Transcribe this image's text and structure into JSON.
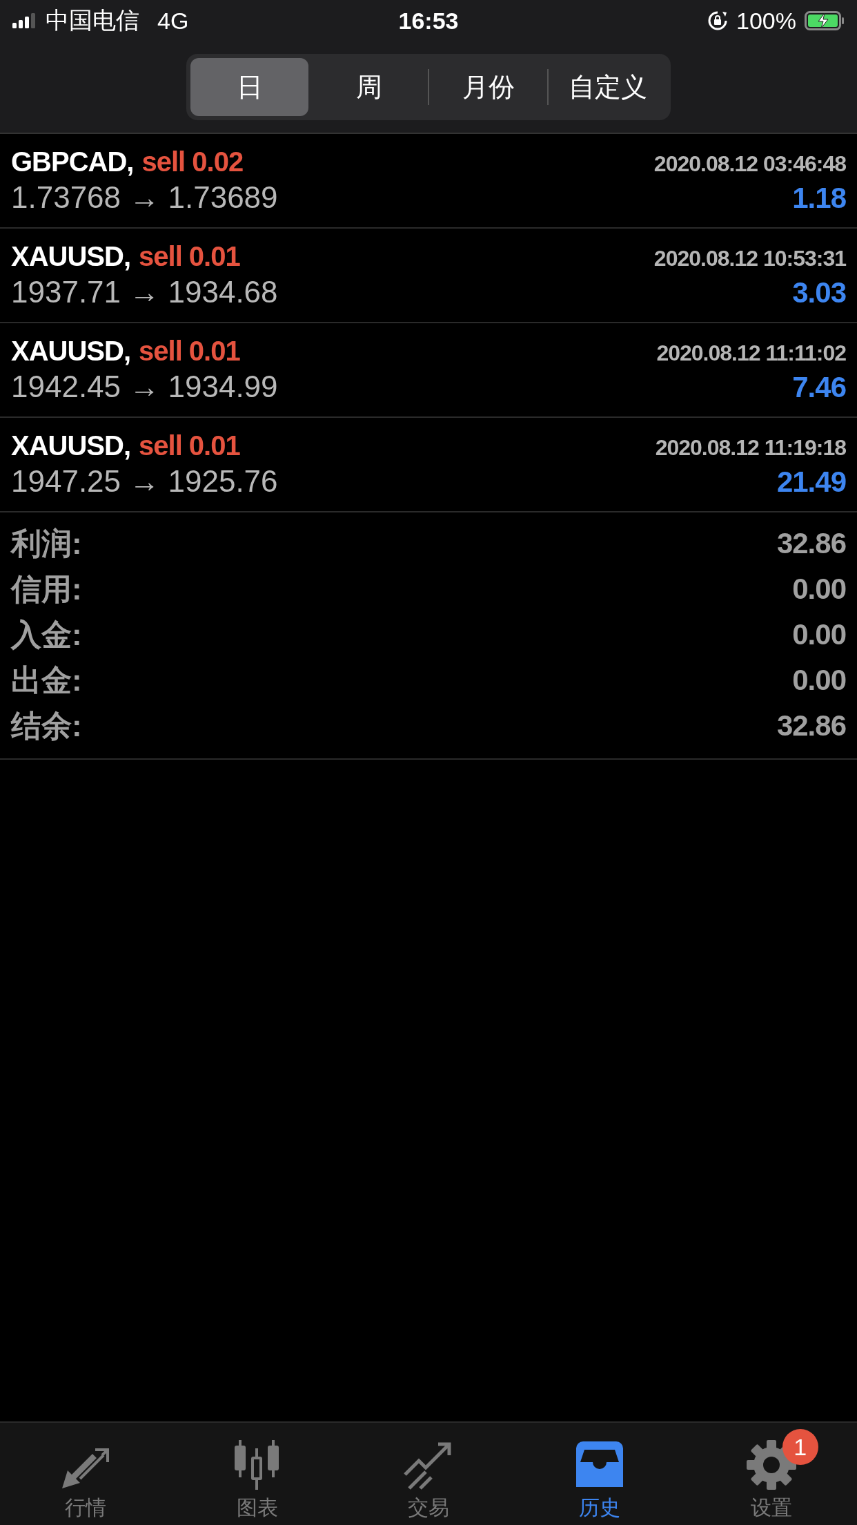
{
  "status_bar": {
    "carrier": "中国电信",
    "network": "4G",
    "time": "16:53",
    "battery": "100%"
  },
  "period_tabs": [
    {
      "label": "日",
      "selected": true
    },
    {
      "label": "周",
      "selected": false
    },
    {
      "label": "月份",
      "selected": false
    },
    {
      "label": "自定义",
      "selected": false
    }
  ],
  "trades": [
    {
      "symbol": "GBPCAD,",
      "side": "sell 0.02",
      "time": "2020.08.12 03:46:48",
      "prices": "1.73768 → 1.73689",
      "profit": "1.18"
    },
    {
      "symbol": "XAUUSD,",
      "side": "sell 0.01",
      "time": "2020.08.12 10:53:31",
      "prices": "1937.71 → 1934.68",
      "profit": "3.03"
    },
    {
      "symbol": "XAUUSD,",
      "side": "sell 0.01",
      "time": "2020.08.12 11:11:02",
      "prices": "1942.45 → 1934.99",
      "profit": "7.46"
    },
    {
      "symbol": "XAUUSD,",
      "side": "sell 0.01",
      "time": "2020.08.12 11:19:18",
      "prices": "1947.25 → 1925.76",
      "profit": "21.49"
    }
  ],
  "summary": [
    {
      "label": "利润:",
      "value": "32.86"
    },
    {
      "label": "信用:",
      "value": "0.00"
    },
    {
      "label": "入金:",
      "value": "0.00"
    },
    {
      "label": "出金:",
      "value": "0.00"
    },
    {
      "label": "结余:",
      "value": "32.86"
    }
  ],
  "tab_bar": [
    {
      "kind": "quotes",
      "label": "行情",
      "selected": false
    },
    {
      "kind": "chart",
      "label": "图表",
      "selected": false
    },
    {
      "kind": "trade",
      "label": "交易",
      "selected": false
    },
    {
      "kind": "history",
      "label": "历史",
      "selected": true
    },
    {
      "kind": "settings",
      "label": "设置",
      "selected": false,
      "badge": "1"
    }
  ]
}
